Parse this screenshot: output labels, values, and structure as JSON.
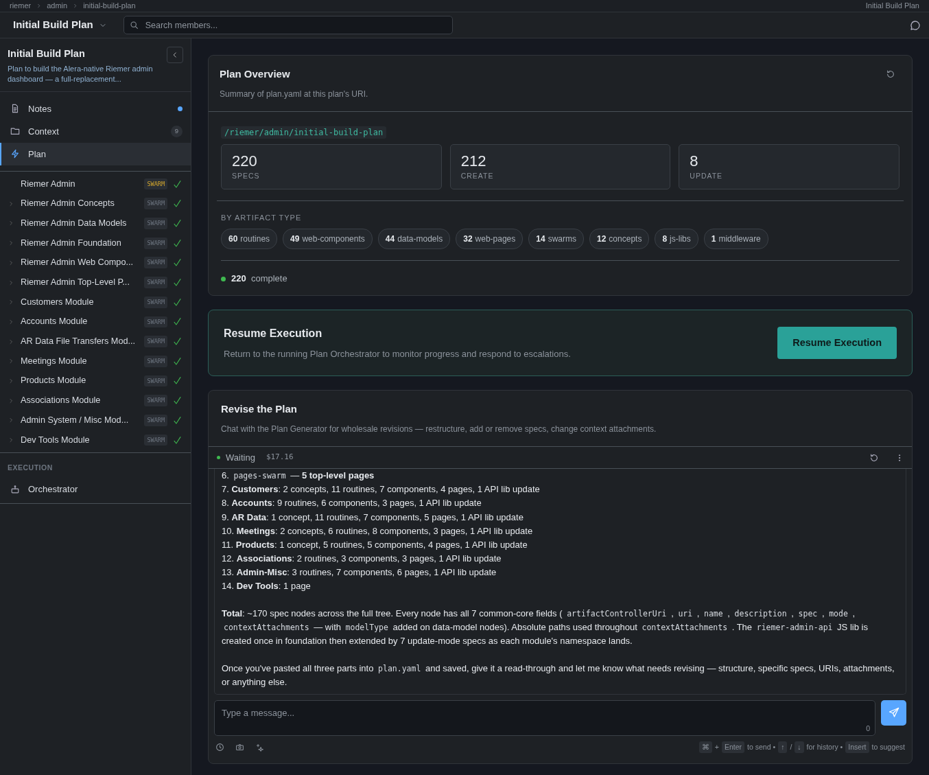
{
  "breadcrumb": [
    "riemer",
    "admin",
    "initial-build-plan"
  ],
  "breadcrumb_right": "Initial Build Plan",
  "header": {
    "title": "Initial Build Plan",
    "search_placeholder": "Search members..."
  },
  "sidebar": {
    "title": "Initial Build Plan",
    "description": "Plan to build the Alera-native Riemer admin dashboard — a full-replacement...",
    "nav": [
      {
        "label": "Notes",
        "unread": true,
        "selected": false
      },
      {
        "label": "Context",
        "count": "9",
        "selected": false
      },
      {
        "label": "Plan",
        "selected": true
      }
    ],
    "tree": [
      {
        "label": "Riemer Admin",
        "badge": "SWARM",
        "highlighted": true,
        "expandable": false,
        "complete": true
      },
      {
        "label": "Riemer Admin Concepts",
        "badge": "SWARM",
        "highlighted": false,
        "expandable": true,
        "complete": true
      },
      {
        "label": "Riemer Admin Data Models",
        "badge": "SWARM",
        "highlighted": false,
        "expandable": true,
        "complete": true
      },
      {
        "label": "Riemer Admin Foundation",
        "badge": "SWARM",
        "highlighted": false,
        "expandable": true,
        "complete": true
      },
      {
        "label": "Riemer Admin Web Compo...",
        "badge": "SWARM",
        "highlighted": false,
        "expandable": true,
        "complete": true
      },
      {
        "label": "Riemer Admin Top-Level P...",
        "badge": "SWARM",
        "highlighted": false,
        "expandable": true,
        "complete": true
      },
      {
        "label": "Customers Module",
        "badge": "SWARM",
        "highlighted": false,
        "expandable": true,
        "complete": true
      },
      {
        "label": "Accounts Module",
        "badge": "SWARM",
        "highlighted": false,
        "expandable": true,
        "complete": true
      },
      {
        "label": "AR Data File Transfers Mod...",
        "badge": "SWARM",
        "highlighted": false,
        "expandable": true,
        "complete": true
      },
      {
        "label": "Meetings Module",
        "badge": "SWARM",
        "highlighted": false,
        "expandable": true,
        "complete": true
      },
      {
        "label": "Products Module",
        "badge": "SWARM",
        "highlighted": false,
        "expandable": true,
        "complete": true
      },
      {
        "label": "Associations Module",
        "badge": "SWARM",
        "highlighted": false,
        "expandable": true,
        "complete": true
      },
      {
        "label": "Admin System / Misc Mod...",
        "badge": "SWARM",
        "highlighted": false,
        "expandable": true,
        "complete": true
      },
      {
        "label": "Dev Tools Module",
        "badge": "SWARM",
        "highlighted": false,
        "expandable": true,
        "complete": true
      }
    ],
    "section_label": "EXECUTION",
    "execution": [
      {
        "label": "Orchestrator",
        "selected": false
      }
    ]
  },
  "overview": {
    "title": "Plan Overview",
    "subtitle": "Summary of plan.yaml at this plan's URI.",
    "uri": "/riemer/admin/initial-build-plan",
    "stats": [
      {
        "value": "220",
        "label": "SPECS"
      },
      {
        "value": "212",
        "label": "CREATE"
      },
      {
        "value": "8",
        "label": "UPDATE"
      }
    ],
    "types_label": "BY ARTIFACT TYPE",
    "types": [
      {
        "count": "60",
        "label": "routines"
      },
      {
        "count": "49",
        "label": "web-components"
      },
      {
        "count": "44",
        "label": "data-models"
      },
      {
        "count": "32",
        "label": "web-pages"
      },
      {
        "count": "14",
        "label": "swarms"
      },
      {
        "count": "12",
        "label": "concepts"
      },
      {
        "count": "8",
        "label": "js-libs"
      },
      {
        "count": "1",
        "label": "middleware"
      }
    ],
    "status": {
      "count": "220",
      "label": "complete",
      "color": "#3fb950"
    }
  },
  "resume": {
    "title": "Resume Execution",
    "subtitle": "Return to the running Plan Orchestrator to monitor progress and respond to escalations.",
    "button": "Resume Execution"
  },
  "revise": {
    "title": "Revise the Plan",
    "subtitle": "Chat with the Plan Generator for wholesale revisions — restructure, add or remove specs, change context attachments.",
    "status": {
      "label": "Waiting",
      "color": "#3fb950"
    },
    "cost": "$17.16",
    "messages": [
      [
        {
          "kind": "text",
          "text": "6. "
        },
        {
          "kind": "code",
          "text": "pages-swarm"
        },
        {
          "kind": "text",
          "text": " — **5 top-level pages**"
        }
      ],
      [
        {
          "kind": "text",
          "text": "7. **Customers**: 2 concepts, 11 routines, 7 components, 4 pages, 1 API lib update"
        }
      ],
      [
        {
          "kind": "text",
          "text": "8. **Accounts**: 9 routines, 6 components, 3 pages, 1 API lib update"
        }
      ],
      [
        {
          "kind": "text",
          "text": "9. **AR Data**: 1 concept, 11 routines, 7 components, 5 pages, 1 API lib update"
        }
      ],
      [
        {
          "kind": "text",
          "text": "10. **Meetings**: 2 concepts, 6 routines, 8 components, 3 pages, 1 API lib update"
        }
      ],
      [
        {
          "kind": "text",
          "text": "11. **Products**: 1 concept, 5 routines, 5 components, 4 pages, 1 API lib update"
        }
      ],
      [
        {
          "kind": "text",
          "text": "12. **Associations**: 2 routines, 3 components, 3 pages, 1 API lib update"
        }
      ],
      [
        {
          "kind": "text",
          "text": "13. **Admin-Misc**: 3 routines, 7 components, 6 pages, 1 API lib update"
        }
      ],
      [
        {
          "kind": "text",
          "text": "14. **Dev Tools**: 1 page"
        }
      ],
      [
        {
          "kind": "text",
          "text": "**Total**: ~170 spec nodes across the full tree. Every node has all 7 common-core fields ( "
        },
        {
          "kind": "code",
          "text": "artifactControllerUri"
        },
        {
          "kind": "text",
          "text": " , "
        },
        {
          "kind": "code",
          "text": "uri"
        },
        {
          "kind": "text",
          "text": " , "
        },
        {
          "kind": "code",
          "text": "name"
        },
        {
          "kind": "text",
          "text": " , "
        },
        {
          "kind": "code",
          "text": "description"
        },
        {
          "kind": "text",
          "text": " , "
        },
        {
          "kind": "code",
          "text": "spec"
        },
        {
          "kind": "text",
          "text": " , "
        },
        {
          "kind": "code",
          "text": "mode"
        },
        {
          "kind": "text",
          "text": " , "
        },
        {
          "kind": "code",
          "text": "contextAttachments"
        },
        {
          "kind": "text",
          "text": " — with "
        },
        {
          "kind": "code",
          "text": "modelType"
        },
        {
          "kind": "text",
          "text": " added on data-model nodes). Absolute paths used throughout "
        },
        {
          "kind": "code",
          "text": "contextAttachments"
        },
        {
          "kind": "text",
          "text": " . The "
        },
        {
          "kind": "code",
          "text": "riemer-admin-api"
        },
        {
          "kind": "text",
          "text": " JS lib is created once in foundation then extended by 7 update-mode specs as each module's namespace lands."
        }
      ],
      [
        {
          "kind": "text",
          "text": "Once you've pasted all three parts into "
        },
        {
          "kind": "code",
          "text": "plan.yaml"
        },
        {
          "kind": "text",
          "text": " and saved, give it a read-through and let me know what needs revising — structure, specific specs, URIs, attachments, or anything else."
        }
      ]
    ],
    "input_placeholder": "Type a message...",
    "char_count": "0",
    "hints": [
      {
        "kind": "key",
        "text": "⌘"
      },
      {
        "kind": "text",
        "text": "+"
      },
      {
        "kind": "key",
        "text": "Enter"
      },
      {
        "kind": "text",
        "text": "to send •"
      },
      {
        "kind": "key",
        "text": "↑"
      },
      {
        "kind": "text",
        "text": "/"
      },
      {
        "kind": "key",
        "text": "↓"
      },
      {
        "kind": "text",
        "text": "for history •"
      },
      {
        "kind": "key",
        "text": "Insert"
      },
      {
        "kind": "text",
        "text": "to suggest"
      }
    ]
  }
}
